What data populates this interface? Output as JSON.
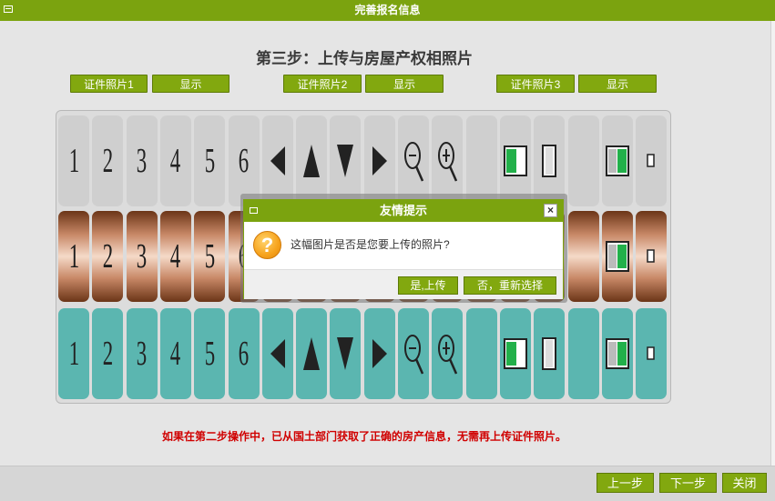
{
  "window": {
    "title": "完善报名信息"
  },
  "step_title": "第三步：上传与房屋产权相照片",
  "photo_buttons": [
    {
      "label": "证件照片1",
      "show_label": "显示"
    },
    {
      "label": "证件照片2",
      "show_label": "显示"
    },
    {
      "label": "证件照片3",
      "show_label": "显示"
    }
  ],
  "grid": {
    "rows": [
      "gray",
      "copper",
      "teal"
    ],
    "cells": [
      {
        "kind": "text",
        "text": "1",
        "icon": "digit-1"
      },
      {
        "kind": "text",
        "text": "2",
        "icon": "digit-2"
      },
      {
        "kind": "text",
        "text": "3",
        "icon": "digit-3"
      },
      {
        "kind": "text",
        "text": "4",
        "icon": "digit-4"
      },
      {
        "kind": "text",
        "text": "5",
        "icon": "digit-5"
      },
      {
        "kind": "text",
        "text": "6",
        "icon": "digit-6"
      },
      {
        "kind": "icon",
        "icon": "arrow-left-icon"
      },
      {
        "kind": "icon",
        "icon": "arrow-up-icon"
      },
      {
        "kind": "icon",
        "icon": "arrow-down-icon"
      },
      {
        "kind": "icon",
        "icon": "arrow-right-icon"
      },
      {
        "kind": "icon",
        "icon": "zoom-out-icon"
      },
      {
        "kind": "icon",
        "icon": "zoom-in-icon"
      },
      {
        "kind": "blank",
        "icon": "blank"
      },
      {
        "kind": "icon",
        "icon": "landscape-icon"
      },
      {
        "kind": "icon",
        "icon": "portrait-icon"
      },
      {
        "kind": "blank",
        "icon": "blank"
      },
      {
        "kind": "icon",
        "icon": "fit-window-icon"
      },
      {
        "kind": "icon",
        "icon": "small-size-icon"
      }
    ]
  },
  "notice": "如果在第二步操作中，已从国土部门获取了正确的房产信息，无需再上传证件照片。",
  "nav": {
    "prev": "上一步",
    "next": "下一步",
    "close": "关闭"
  },
  "dialog": {
    "title": "友情提示",
    "close_glyph": "×",
    "icon": "question-icon",
    "icon_glyph": "?",
    "message": "这幅图片是否是您要上传的照片?",
    "confirm": "是,上传",
    "reselect": "否，重新选择"
  },
  "colors": {
    "accent": "#7ba30f",
    "teal": "#5bb6b0",
    "notice": "#d00000"
  }
}
